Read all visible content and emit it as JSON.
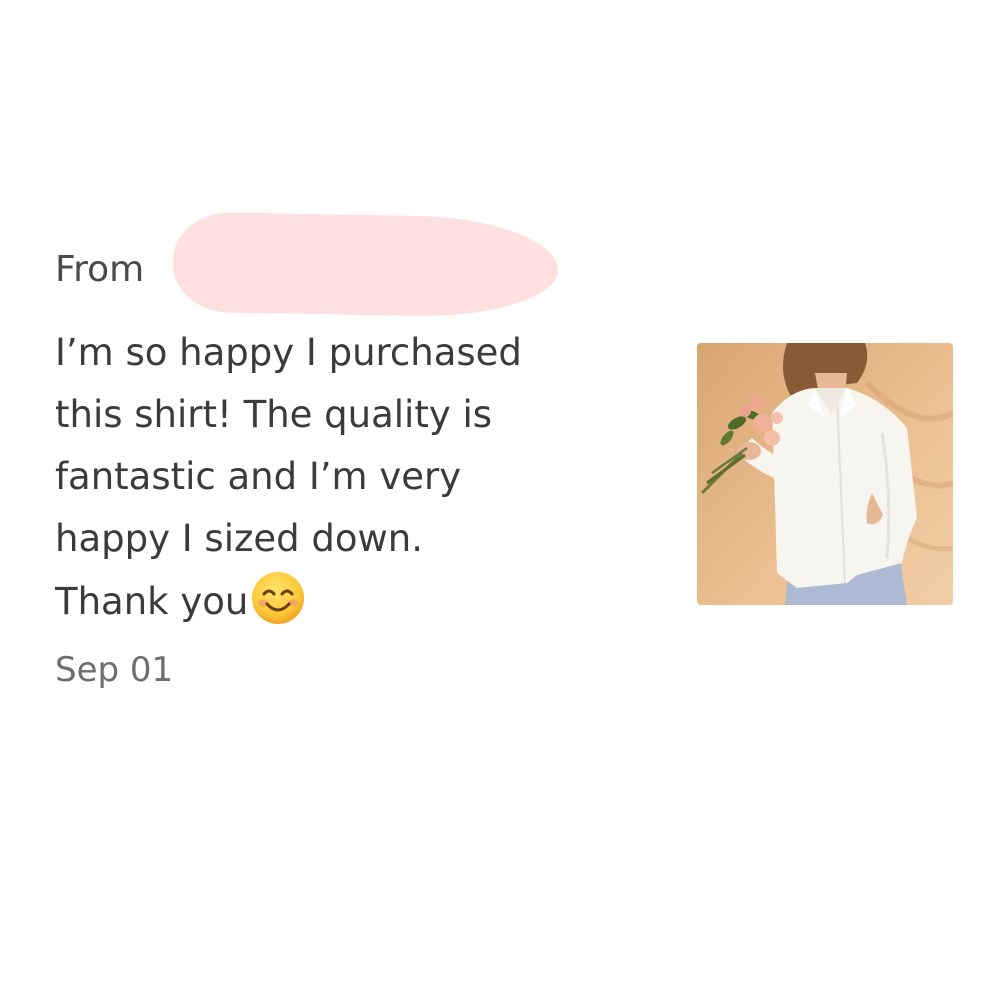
{
  "review": {
    "from_label": "From",
    "reviewer_name_redacted": true,
    "message": "I’m so happy I purchased\nthis shirt! The quality is\nfantastic and I’m very\nhappy I sized down.\nThank you",
    "emoji": "smiling-face-with-smiling-eyes-icon",
    "date": "Sep 01"
  },
  "product_photo": {
    "subject": "woman in white button-up shirt holding flowers",
    "background_color": "#e7b889",
    "shirt_color": "#f7f5f0"
  },
  "colors": {
    "text_primary": "#3b3b3b",
    "text_secondary": "#6e6e6e",
    "redaction": "#fde0df"
  }
}
